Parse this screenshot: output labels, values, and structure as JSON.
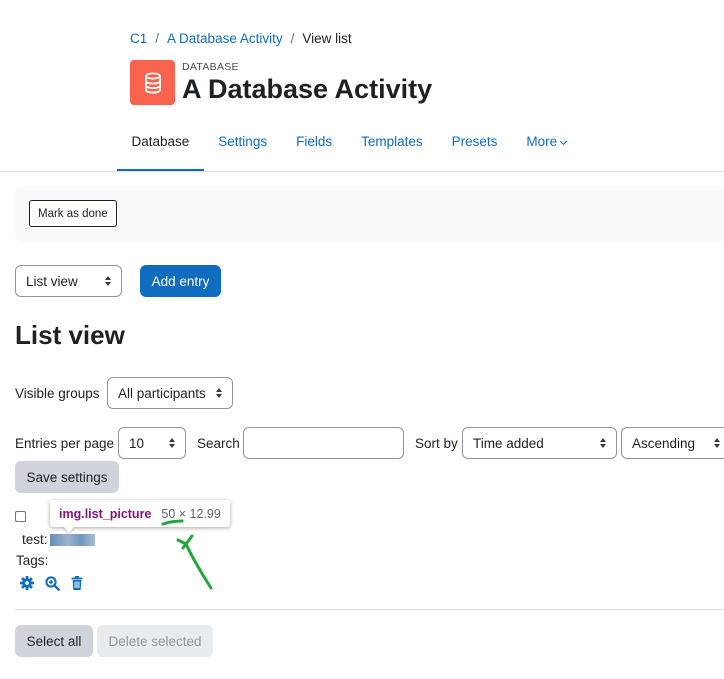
{
  "breadcrumb": {
    "items": [
      "C1",
      "A Database Activity"
    ],
    "separator": "/",
    "current": "View list"
  },
  "header": {
    "module_label": "DATABASE",
    "title": "A Database Activity",
    "icon": "database-icon",
    "icon_color": "#f7634d"
  },
  "tabs": [
    "Database",
    "Settings",
    "Fields",
    "Templates",
    "Presets",
    "More"
  ],
  "completion": {
    "mark_done_label": "Mark as done"
  },
  "toolbar": {
    "view_select_value": "List view",
    "add_entry_label": "Add entry"
  },
  "page_heading": "List view",
  "filters": {
    "visible_groups_label": "Visible groups",
    "visible_groups_value": "All participants",
    "entries_per_page_label": "Entries per page",
    "entries_per_page_value": "10",
    "search_label": "Search",
    "search_value": "",
    "sort_by_label": "Sort by",
    "sort_by_value": "Time added",
    "order_value": "Ascending",
    "save_settings_label": "Save settings"
  },
  "entry": {
    "test_label": "test:",
    "tags_label": "Tags:",
    "action_icons": [
      "gear-icon",
      "zoom-in-icon",
      "trash-icon"
    ]
  },
  "devtools_tooltip": {
    "selector": "img.list_picture",
    "dimensions": "50 × 12.99"
  },
  "footer": {
    "select_all_label": "Select all",
    "delete_selected_label": "Delete selected"
  },
  "colors": {
    "primary": "#0f6cbf",
    "annotation_arrow": "#1fa63c"
  }
}
